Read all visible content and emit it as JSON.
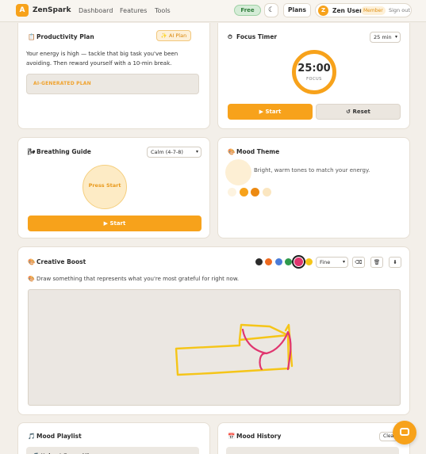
{
  "nav": {
    "logo_letter": "A",
    "brand": "ZenSpark",
    "links": [
      "Dashboard",
      "Features",
      "Tools"
    ],
    "plan_badge": "Free",
    "theme_icon": "moon-icon",
    "plans_button": "Plans",
    "user": {
      "initial": "Z",
      "name": "Zen User",
      "role": "Member",
      "signout": "Sign out"
    }
  },
  "productivity": {
    "icon": "clipboard-icon",
    "title": "Productivity Plan",
    "ai_button": "✨ AI Plan",
    "text": "Your energy is high — tackle that big task you've been avoiding. Then reward yourself with a 10-min break.",
    "generated_label": "AI-GENERATED PLAN"
  },
  "focus": {
    "icon": "stopwatch-icon",
    "title": "Focus Timer",
    "duration": "25 min",
    "time": "25:00",
    "label": "FOCUS",
    "start": "▶ Start",
    "reset": "↺ Reset"
  },
  "breathing": {
    "icon": "wind-icon",
    "title": "Breathing Guide",
    "pattern": "Calm (4-7-8)",
    "circle_text": "Press Start",
    "start": "▶ Start"
  },
  "mood_theme": {
    "icon": "palette-icon",
    "title": "Mood Theme",
    "description": "Bright, warm tones to match your energy.",
    "swatches": [
      "#fdf3e0",
      "#f7a21b",
      "#ec8a12",
      "#fbe6c0"
    ]
  },
  "creative": {
    "icon": "palette-icon",
    "title": "Creative Boost",
    "colors": [
      "#2b2b2b",
      "#ee6a1f",
      "#4a7bd8",
      "#2f9a4c",
      "#e0356f",
      "#f5c518"
    ],
    "selected_color": "#e0356f",
    "brush": "Fine",
    "tools": [
      "eraser-icon",
      "trash-icon",
      "download-icon"
    ],
    "prompt": "🎨 Draw something that represents what you're most grateful for right now."
  },
  "playlist": {
    "icon": "music-icon",
    "title": "Mood Playlist",
    "first_item": "🎵 Upbeat Focus Mix"
  },
  "history": {
    "icon": "calendar-icon",
    "title": "Mood History",
    "clear": "Clear"
  },
  "chat": {
    "icon": "chat-icon"
  }
}
